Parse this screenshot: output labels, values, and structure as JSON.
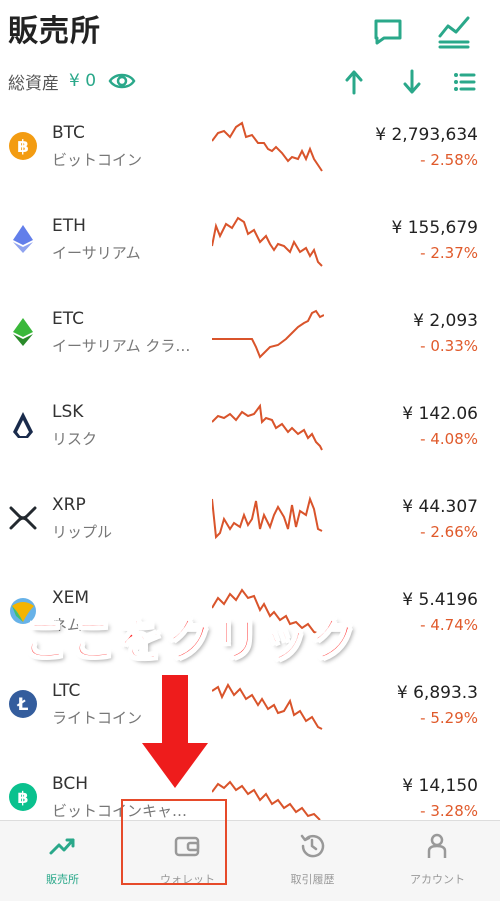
{
  "header": {
    "title": "販売所",
    "assets_label": "総資産",
    "assets_value": "¥ 0",
    "icons": [
      "chat-icon",
      "chart-icon",
      "eye-icon",
      "sort-up-icon",
      "sort-down-icon",
      "list-icon"
    ]
  },
  "colors": {
    "accent": "#2aa88a",
    "negative": "#e05a2b",
    "callout": "#ff2222"
  },
  "coins": [
    {
      "symbol": "BTC",
      "name": "ビットコイン",
      "price": "¥ 2,793,634",
      "change": "- 2.58%",
      "icon": "bitcoin-icon",
      "color": "#f39c12"
    },
    {
      "symbol": "ETH",
      "name": "イーサリアム",
      "price": "¥ 155,679",
      "change": "- 2.37%",
      "icon": "ethereum-icon",
      "color": "#627eea"
    },
    {
      "symbol": "ETC",
      "name": "イーサリアム クラ…",
      "price": "¥ 2,093",
      "change": "- 0.33%",
      "icon": "ethereum-classic-icon",
      "color": "#3ab83a"
    },
    {
      "symbol": "LSK",
      "name": "リスク",
      "price": "¥ 142.06",
      "change": "- 4.08%",
      "icon": "lisk-icon",
      "color": "#1a2b4c"
    },
    {
      "symbol": "XRP",
      "name": "リップル",
      "price": "¥ 44.307",
      "change": "- 2.66%",
      "icon": "ripple-icon",
      "color": "#23292f"
    },
    {
      "symbol": "XEM",
      "name": "ネム",
      "price": "¥ 5.4196",
      "change": "- 4.74%",
      "icon": "nem-icon",
      "color": "#67b2e8"
    },
    {
      "symbol": "LTC",
      "name": "ライトコイン",
      "price": "¥ 6,893.3",
      "change": "- 5.29%",
      "icon": "litecoin-icon",
      "color": "#345d9d"
    },
    {
      "symbol": "BCH",
      "name": "ビットコインキャ…",
      "price": "¥ 14,150",
      "change": "- 3.28%",
      "icon": "bitcoin-cash-icon",
      "color": "#0ac18e"
    }
  ],
  "tabs": [
    {
      "label": "販売所",
      "icon": "trend-icon",
      "active": true
    },
    {
      "label": "ウォレット",
      "icon": "wallet-icon",
      "active": false
    },
    {
      "label": "取引履歴",
      "icon": "history-icon",
      "active": false
    },
    {
      "label": "アカウント",
      "icon": "account-icon",
      "active": false
    }
  ],
  "annotation": {
    "callout_text": "ここをクリック",
    "target": "ウォレット"
  }
}
